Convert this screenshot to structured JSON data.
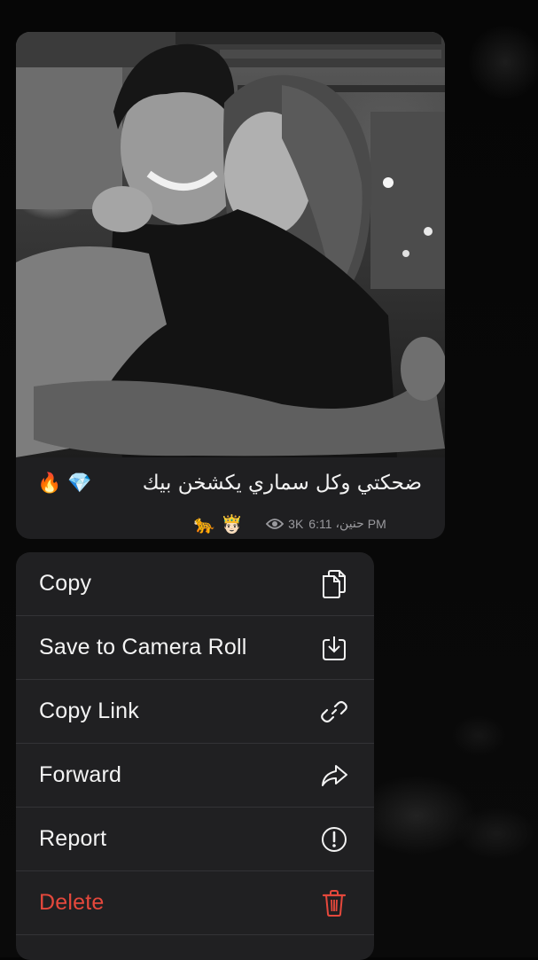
{
  "message": {
    "caption": "ضحكتي وكل سماري يكشخن بيك",
    "caption_emoji": "🔥 💎",
    "emoji_pair": "🐆 🤴🏻",
    "views": "3K",
    "time": "6:11 PM",
    "time_time": "6:11",
    "time_ampm": "PM",
    "author": "حنين،",
    "icons": [
      "photo",
      "eye-icon"
    ]
  },
  "context_menu": {
    "items": [
      {
        "label": "Copy",
        "icon": "copy-icon"
      },
      {
        "label": "Save to Camera Roll",
        "icon": "save-download-icon"
      },
      {
        "label": "Copy Link",
        "icon": "link-icon"
      },
      {
        "label": "Forward",
        "icon": "forward-arrow-icon"
      },
      {
        "label": "Report",
        "icon": "exclamation-circle-icon"
      },
      {
        "label": "Delete",
        "icon": "trash-icon",
        "color": "#e5483c"
      }
    ]
  },
  "colors": {
    "background": "#050505",
    "bubble": "#1f1f21",
    "menu": "#212123",
    "text": "#f4f4f4",
    "meta": "#9a9a9e",
    "danger": "#e5483c"
  }
}
